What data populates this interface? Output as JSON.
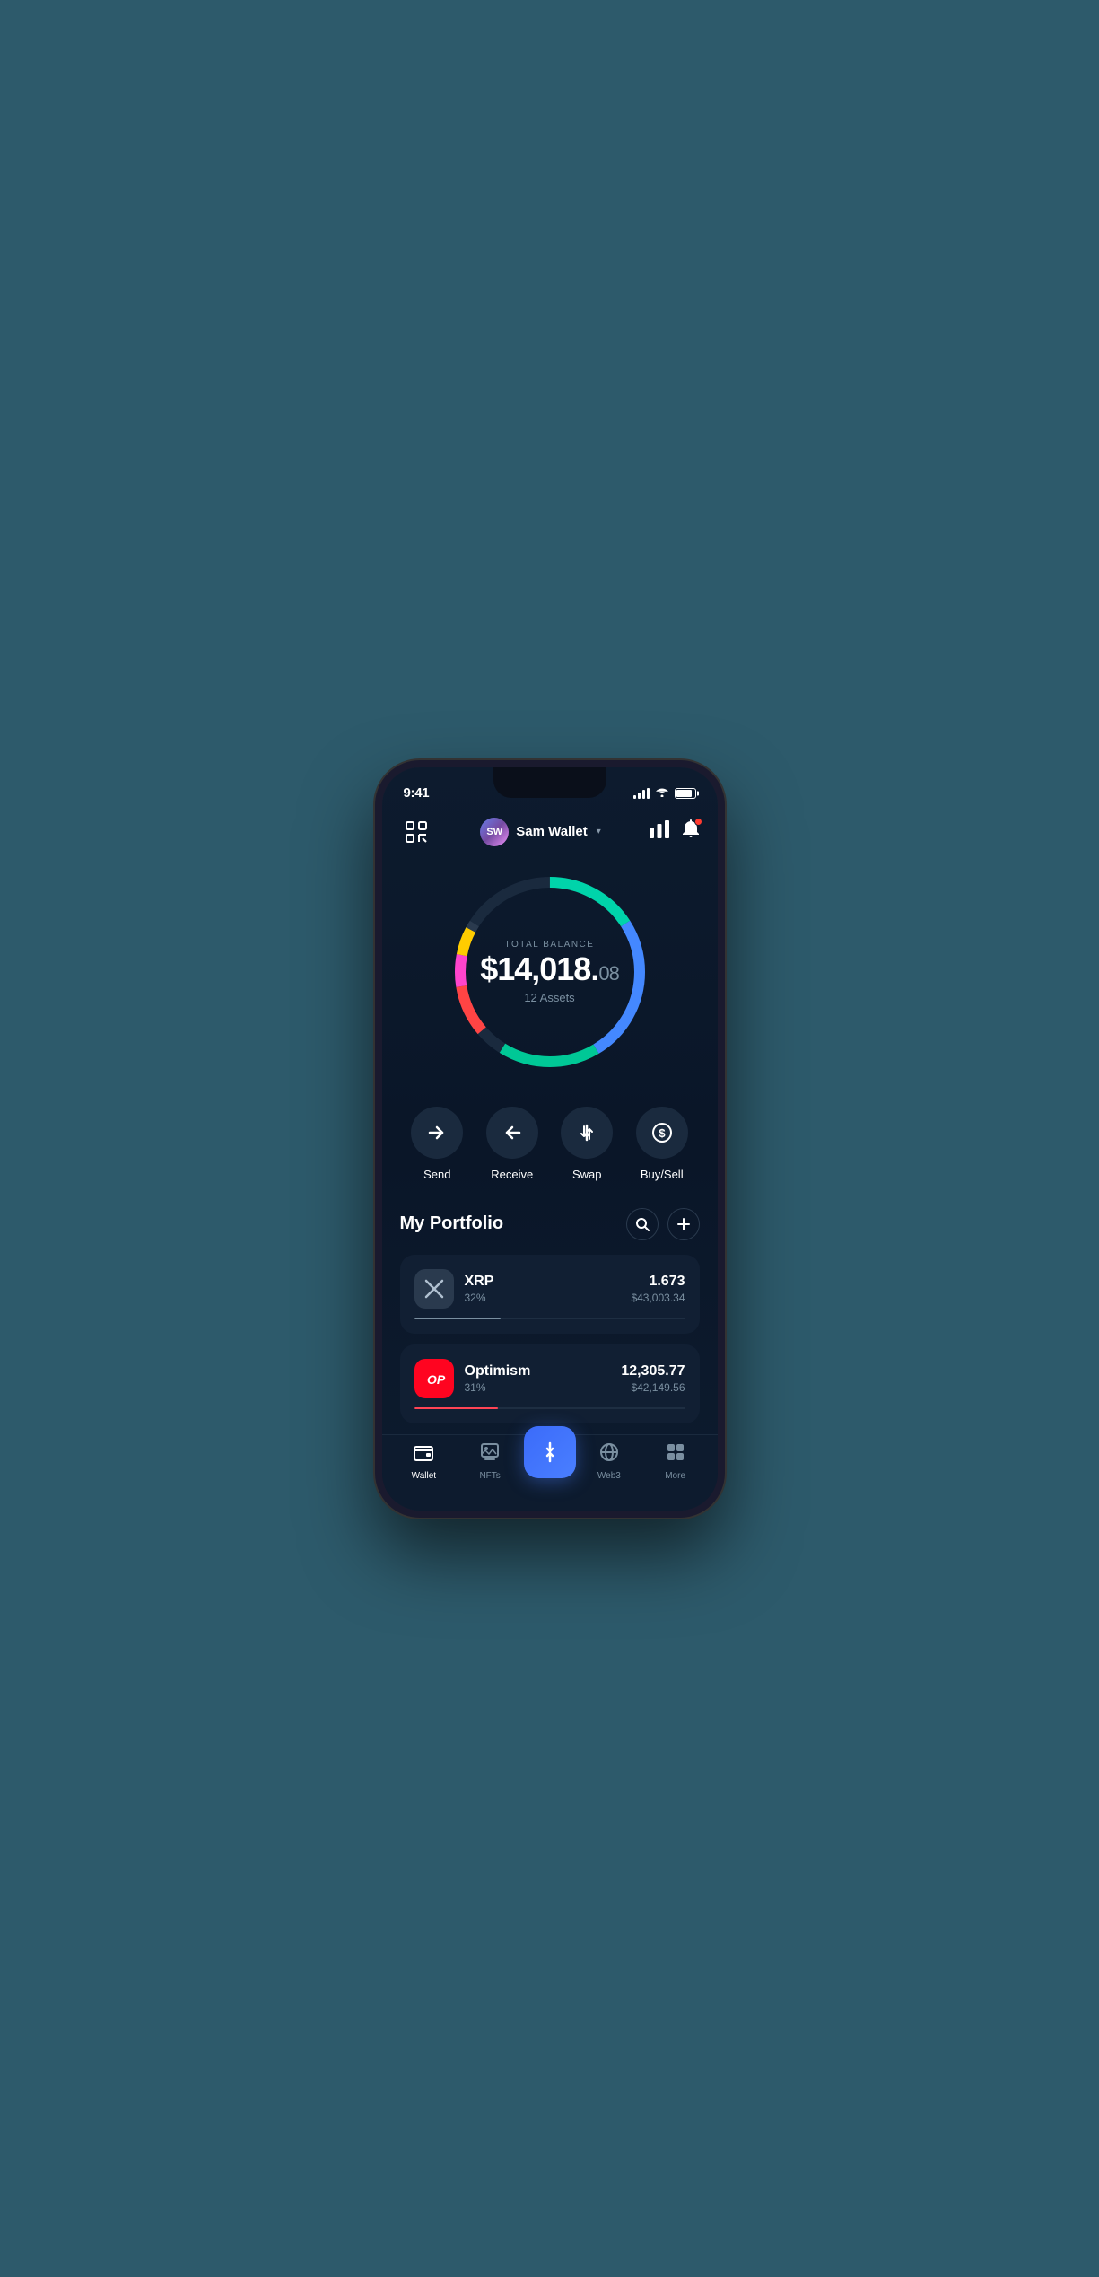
{
  "status": {
    "time": "9:41"
  },
  "header": {
    "wallet_name": "Sam Wallet",
    "wallet_initials": "SW",
    "scan_label": "scan",
    "chart_label": "chart",
    "bell_label": "notifications"
  },
  "balance": {
    "label": "TOTAL BALANCE",
    "amount": "$14,018.",
    "cents": "08",
    "assets": "12 Assets"
  },
  "actions": [
    {
      "id": "send",
      "label": "Send",
      "icon": "→"
    },
    {
      "id": "receive",
      "label": "Receive",
      "icon": "←"
    },
    {
      "id": "swap",
      "label": "Swap",
      "icon": "⇅"
    },
    {
      "id": "buysell",
      "label": "Buy/Sell",
      "icon": "$"
    }
  ],
  "portfolio": {
    "title": "My Portfolio",
    "search_label": "search",
    "add_label": "add"
  },
  "assets": [
    {
      "id": "xrp",
      "name": "XRP",
      "percent": "32%",
      "amount": "1.673",
      "usd": "$43,003.34",
      "progress": 32,
      "color": "#7a8fa0"
    },
    {
      "id": "optimism",
      "name": "Optimism",
      "percent": "31%",
      "amount": "12,305.77",
      "usd": "$42,149.56",
      "progress": 31,
      "color": "#ff4455"
    }
  ],
  "nav": {
    "items": [
      {
        "id": "wallet",
        "label": "Wallet",
        "active": true
      },
      {
        "id": "nfts",
        "label": "NFTs",
        "active": false
      },
      {
        "id": "center",
        "label": "",
        "active": false
      },
      {
        "id": "web3",
        "label": "Web3",
        "active": false
      },
      {
        "id": "more",
        "label": "More",
        "active": false
      }
    ]
  }
}
